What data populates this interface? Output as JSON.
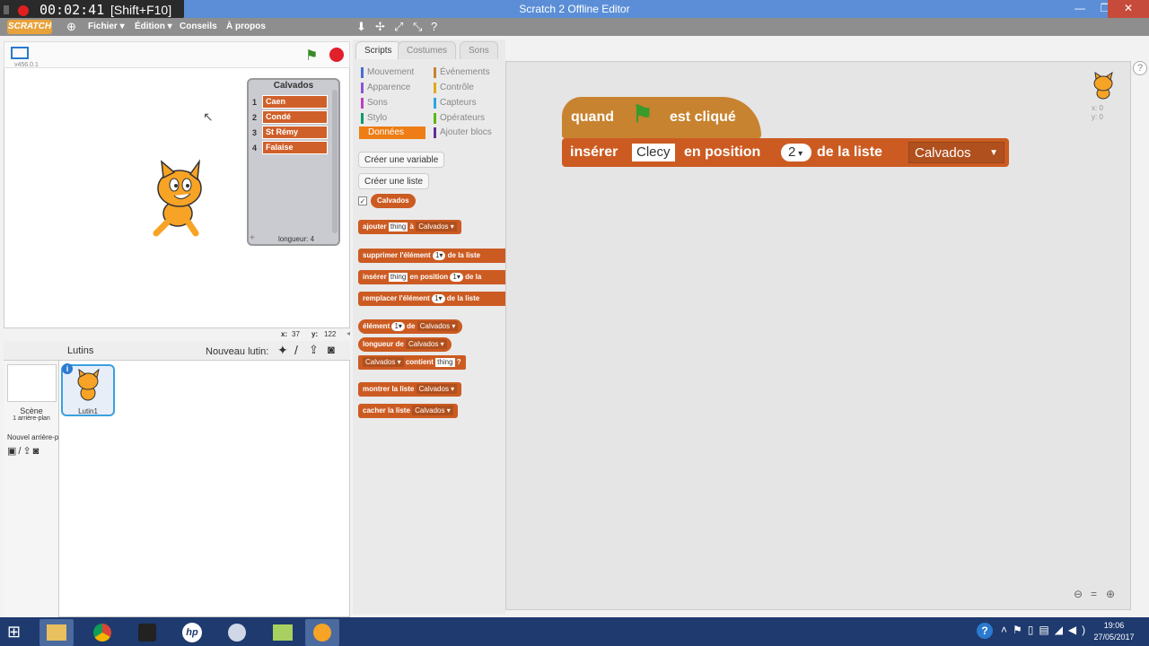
{
  "window": {
    "title": "Scratch 2 Offline Editor"
  },
  "recorder": {
    "time": "00:02:41",
    "shortcut": "[Shift+F10]"
  },
  "menu": {
    "logo": "SCRATCH",
    "items": [
      "Fichier ▾",
      "Édition ▾",
      "Conseils",
      "À propos"
    ]
  },
  "stage": {
    "version": "v456.0.1",
    "list_monitor": {
      "title": "Calvados",
      "items": [
        "Caen",
        "Condé",
        "St Rémy",
        "Falaise"
      ],
      "length_label": "longueur: 4",
      "add": "+"
    },
    "coords": {
      "x_label": "x:",
      "x": "37",
      "y_label": "y:",
      "y": "122"
    }
  },
  "sprites": {
    "header": "Lutins",
    "new_sprite_label": "Nouveau lutin:",
    "scene_label": "Scène",
    "scene_sub": "1 arrière-plan",
    "new_backdrop_label": "Nouvel arrière-p",
    "sprite_name": "Lutin1",
    "info": "i"
  },
  "tabs": [
    "Scripts",
    "Costumes",
    "Sons"
  ],
  "categories": [
    {
      "label": "Mouvement",
      "color": "#4a6cd4"
    },
    {
      "label": "Événements",
      "color": "#c88330"
    },
    {
      "label": "Apparence",
      "color": "#8a55d7"
    },
    {
      "label": "Contrôle",
      "color": "#e1a91a"
    },
    {
      "label": "Sons",
      "color": "#bb42c3"
    },
    {
      "label": "Capteurs",
      "color": "#2ca5e2"
    },
    {
      "label": "Stylo",
      "color": "#0e9a6c"
    },
    {
      "label": "Opérateurs",
      "color": "#5cb712"
    },
    {
      "label": "Données",
      "color": "#ee7d16"
    },
    {
      "label": "Ajouter blocs",
      "color": "#632d99"
    }
  ],
  "palette": {
    "make_variable": "Créer une variable",
    "make_list": "Créer une liste",
    "list_reporter": "Calvados",
    "checkbox": "✓",
    "blocks": {
      "add": [
        "ajouter",
        "thing",
        "à",
        "Calvados ▾"
      ],
      "delete": [
        "supprimer l'élément",
        "1▾",
        "de la liste"
      ],
      "insert": [
        "insérer",
        "thing",
        "en position",
        "1▾",
        "de la"
      ],
      "replace": [
        "remplacer l'élément",
        "1▾",
        "de la liste"
      ],
      "item": [
        "élément",
        "1▾",
        "de",
        "Calvados ▾"
      ],
      "length": [
        "longueur de",
        "Calvados ▾"
      ],
      "contains": [
        "Calvados ▾",
        "contient",
        "thing",
        "?"
      ],
      "show": [
        "montrer la liste",
        "Calvados ▾"
      ],
      "hide": [
        "cacher la liste",
        "Calvados ▾"
      ]
    }
  },
  "script": {
    "hat": {
      "w1": "quand",
      "w2": "est cliqué"
    },
    "insert": {
      "w1": "insérer",
      "value": "Clecy",
      "w2": "en position",
      "pos": "2",
      "w3": "de la liste",
      "list": "Calvados"
    }
  },
  "sprite_corner": {
    "x": "x: 0",
    "y": "y: 0"
  },
  "help": "?",
  "taskbar": {
    "time": "19:06",
    "date": "27/05/2017"
  }
}
